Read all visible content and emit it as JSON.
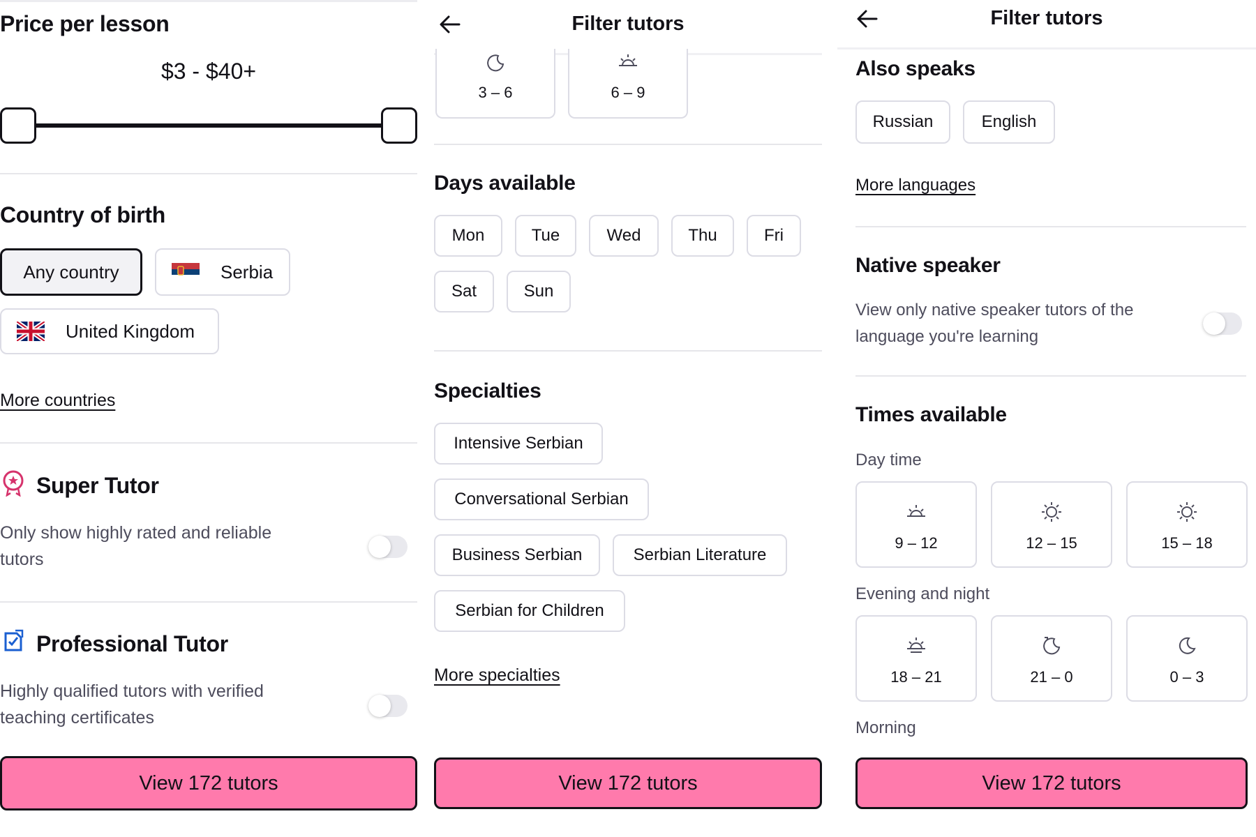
{
  "panel1": {
    "price_title": "Price per lesson",
    "price_range": "$3 - $40+",
    "price_fraction": {
      "min": 0.0,
      "max": 1.0
    },
    "country_title": "Country of birth",
    "country_chips": [
      {
        "label": "Any country",
        "selected": true
      },
      {
        "label": "Serbia",
        "flag": "serbia-flag-icon"
      },
      {
        "label": "United Kingdom",
        "flag": "uk-flag-icon"
      }
    ],
    "more_countries": "More countries",
    "super_title": "Super Tutor",
    "super_desc": "Only show highly rated and reliable tutors",
    "pro_title": "Professional Tutor",
    "pro_desc": "Highly qualified tutors with verified teaching certificates",
    "cta": "View 172 tutors"
  },
  "panel2": {
    "header_title": "Filter tutors",
    "top_times": [
      {
        "label": "3 – 6",
        "icon": "moon-arrow-icon"
      },
      {
        "label": "6 – 9",
        "icon": "sunrise-icon"
      }
    ],
    "days_title": "Days available",
    "days": [
      "Mon",
      "Tue",
      "Wed",
      "Thu",
      "Fri",
      "Sat",
      "Sun"
    ],
    "spec_title": "Specialties",
    "specialties": [
      "Intensive Serbian",
      "Conversational Serbian",
      "Business Serbian",
      "Serbian Literature",
      "Serbian for Children"
    ],
    "more_specialties": "More specialties",
    "cta": "View 172 tutors"
  },
  "panel3": {
    "header_title": "Filter tutors",
    "also_title": "Also speaks",
    "languages": [
      "Russian",
      "English"
    ],
    "more_languages": "More languages",
    "native_title": "Native speaker",
    "native_desc": "View only native speaker tutors of the language you're learning",
    "times_title": "Times available",
    "daytime_label": "Day time",
    "daytime": [
      {
        "label": "9 – 12",
        "icon": "sunrise-icon"
      },
      {
        "label": "12 – 15",
        "icon": "sun-icon"
      },
      {
        "label": "15 – 18",
        "icon": "sun-icon"
      }
    ],
    "evening_label": "Evening and night",
    "evening": [
      {
        "label": "18 – 21",
        "icon": "sunset-icon"
      },
      {
        "label": "21 – 0",
        "icon": "moon-arrow-icon"
      },
      {
        "label": "0 – 3",
        "icon": "moon-icon"
      }
    ],
    "morning_label": "Morning",
    "cta": "View 172 tutors"
  },
  "colors": {
    "accent": "#ff7aac",
    "text": "#121117",
    "muted": "#4d4c5c",
    "border": "#dcdce5",
    "super_icon": "#d6336c",
    "pro_icon": "#1a5fd1"
  }
}
